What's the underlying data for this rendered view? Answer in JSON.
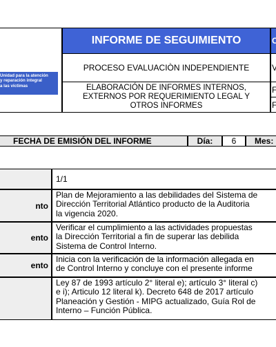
{
  "header": {
    "logo_text": [
      "Unidad para la atención",
      "y reparación integral",
      "a las víctimas"
    ],
    "title": "INFORME DE SEGUIMIENTO",
    "title_right": "C",
    "proceso": "PROCESO EVALUACIÒN INDEPENDIENTE",
    "proceso_right": "V",
    "elaboracion": [
      "ELABORACIÓN DE INFORMES INTERNOS,",
      "EXTERNOS POR REQUERIMIENTO LEGAL Y",
      "OTROS INFORMES"
    ],
    "elab_right_1": "F",
    "elab_right_2": "F"
  },
  "fecha": {
    "label": "FECHA DE EMISIÓN DEL INFORME",
    "dia_label": "Día:",
    "dia_value": "6",
    "mes_label": "Mes:"
  },
  "rows": [
    {
      "label": "",
      "lines": [
        "1/1"
      ]
    },
    {
      "label": "nto",
      "lines": [
        "Plan de Mejoramiento a las debilidades del Sistema de",
        "Dirección Territorial Atlántico producto de la Auditoria",
        "la vigencia 2020."
      ]
    },
    {
      "label": "ento",
      "lines": [
        "Verificar el cumplimiento a las actividades propuestas",
        "la Dirección Territorial a fin de superar las debilida",
        "Sistema de Control Interno."
      ]
    },
    {
      "label": "ento",
      "lines": [
        "Inicia con la verificación de la información allegada en",
        "de Control Interno y concluye con el presente informe"
      ]
    },
    {
      "label": "",
      "lines": [
        "Ley 87 de 1993 artículo 2° literal e); artículo 3° literal c)",
        "e i); Articulo 12 literal k). Decreto 648 de 2017 artículo",
        "Planeación y Gestión - MIPG actualizado, Guía Rol de",
        "Interno – Función Pública."
      ]
    }
  ]
}
